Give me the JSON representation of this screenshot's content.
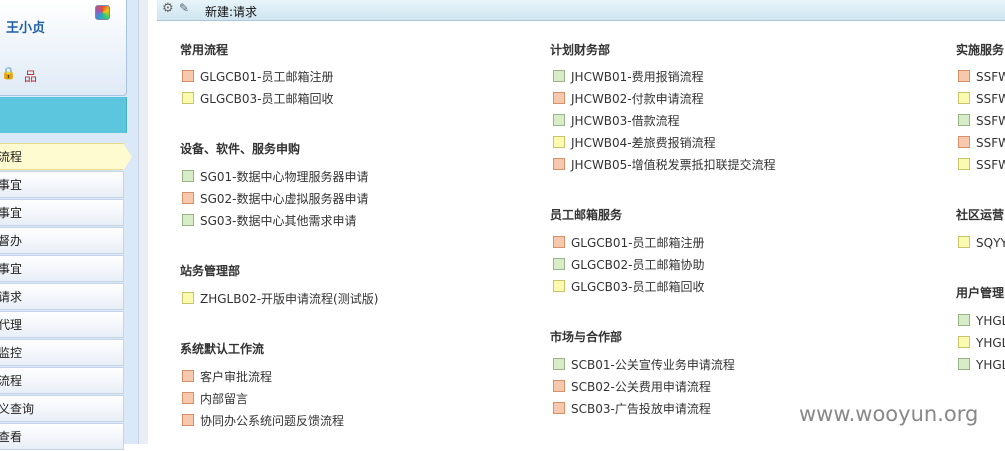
{
  "sidebar": {
    "user_name": "王小贞",
    "menu_items": [
      {
        "label": "流程",
        "active": true
      },
      {
        "label": "事宜"
      },
      {
        "label": "事宜"
      },
      {
        "label": "督办"
      },
      {
        "label": "事宜"
      },
      {
        "label": "请求"
      },
      {
        "label": "代理"
      },
      {
        "label": "监控"
      },
      {
        "label": "流程"
      },
      {
        "label": "义查询"
      },
      {
        "label": "查看"
      }
    ]
  },
  "toolbar": {
    "title": "新建:请求"
  },
  "columns": [
    {
      "sections": [
        {
          "title": "常用流程",
          "items": [
            {
              "label": "GLGCB01-员工邮箱注册",
              "color": "orange"
            },
            {
              "label": "GLGCB03-员工邮箱回收",
              "color": "yellow"
            }
          ]
        },
        {
          "title": "设备、软件、服务申购",
          "items": [
            {
              "label": "SG01-数据中心物理服务器申请",
              "color": "green"
            },
            {
              "label": "SG02-数据中心虚拟服务器申请",
              "color": "orange"
            },
            {
              "label": "SG03-数据中心其他需求申请",
              "color": "green"
            }
          ]
        },
        {
          "title": "站务管理部",
          "items": [
            {
              "label": "ZHGLB02-开版申请流程(测试版)",
              "color": "yellow"
            }
          ]
        },
        {
          "title": "系统默认工作流",
          "items": [
            {
              "label": "客户审批流程",
              "color": "orange"
            },
            {
              "label": "内部留言",
              "color": "orange"
            },
            {
              "label": "协同办公系统问题反馈流程",
              "color": "orange"
            }
          ]
        }
      ]
    },
    {
      "sections": [
        {
          "title": "计划财务部",
          "items": [
            {
              "label": "JHCWB01-费用报销流程",
              "color": "green"
            },
            {
              "label": "JHCWB02-付款申请流程",
              "color": "orange"
            },
            {
              "label": "JHCWB03-借款流程",
              "color": "green"
            },
            {
              "label": "JHCWB04-差旅费报销流程",
              "color": "yellow"
            },
            {
              "label": "JHCWB05-增值税发票抵扣联提交流程",
              "color": "orange"
            }
          ]
        },
        {
          "title": "员工邮箱服务",
          "items": [
            {
              "label": "GLGCB01-员工邮箱注册",
              "color": "orange"
            },
            {
              "label": "GLGCB02-员工邮箱协助",
              "color": "green"
            },
            {
              "label": "GLGCB03-员工邮箱回收",
              "color": "yellow"
            }
          ]
        },
        {
          "title": "市场与合作部",
          "items": [
            {
              "label": "SCB01-公关宣传业务申请流程",
              "color": "green"
            },
            {
              "label": "SCB02-公关费用申请流程",
              "color": "orange"
            },
            {
              "label": "SCB03-广告投放申请流程",
              "color": "orange"
            }
          ]
        }
      ]
    },
    {
      "sections": [
        {
          "title": "实施服务",
          "items": [
            {
              "label": "SSFW",
              "color": "orange"
            },
            {
              "label": "SSFW",
              "color": "yellow"
            },
            {
              "label": "SSFW",
              "color": "green"
            },
            {
              "label": "SSFW",
              "color": "orange"
            },
            {
              "label": "SSFW",
              "color": "yellow"
            }
          ]
        },
        {
          "title": "社区运营",
          "items": [
            {
              "label": "SQYY",
              "color": "yellow"
            }
          ]
        },
        {
          "title": "用户管理",
          "items": [
            {
              "label": "YHGL",
              "color": "green"
            },
            {
              "label": "YHGL",
              "color": "yellow"
            },
            {
              "label": "YHGL",
              "color": "green"
            }
          ]
        }
      ]
    }
  ],
  "watermark": "www.wooyun.org"
}
